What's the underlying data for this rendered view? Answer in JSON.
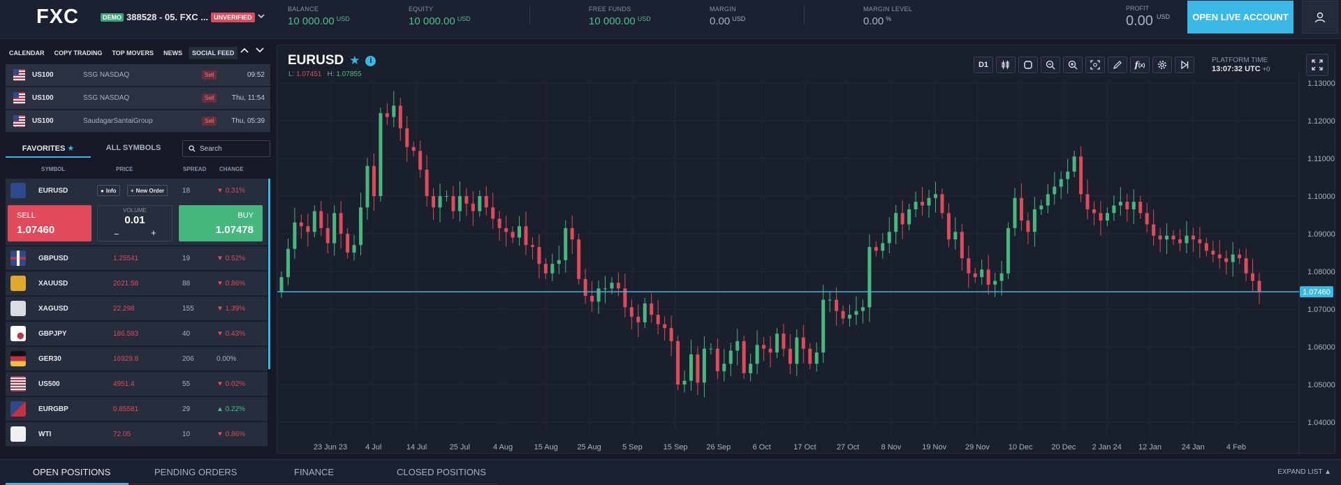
{
  "brand": "FXC",
  "account": {
    "demo": "DEMO",
    "number": "388528 - 05. FXC ...",
    "status": "UNVERIFIED"
  },
  "metrics": [
    {
      "label": "BALANCE",
      "value": "10 000.00",
      "unit": "USD",
      "tone": "green"
    },
    {
      "label": "EQUITY",
      "value": "10 000.00",
      "unit": "USD",
      "tone": "green"
    },
    {
      "label": "FREE FUNDS",
      "value": "10 000.00",
      "unit": "USD",
      "tone": "green"
    },
    {
      "label": "MARGIN",
      "value": "0.00",
      "unit": "USD",
      "tone": "grey"
    },
    {
      "label": "MARGIN LEVEL",
      "value": "0.00",
      "unit": "%",
      "tone": "grey"
    }
  ],
  "profit": {
    "label": "PROFIT",
    "value": "0.00",
    "unit": "USD"
  },
  "open_live": "OPEN LIVE ACCOUNT",
  "left_tabs": [
    "CALENDAR",
    "COPY TRADING",
    "TOP MOVERS",
    "NEWS",
    "SOCIAL FEED"
  ],
  "feed": [
    {
      "symbol": "US100",
      "group": "SSG NASDAQ",
      "side": "Sell",
      "time": "09:52"
    },
    {
      "symbol": "US100",
      "group": "SSG NASDAQ",
      "side": "Sell",
      "time": "Thu, 11:54"
    },
    {
      "symbol": "US100",
      "group": "SaudagarSantaiGroup",
      "side": "Sell",
      "time": "Thu, 05:39"
    }
  ],
  "fav_tabs": {
    "favorites": "FAVORITES",
    "all": "ALL SYMBOLS"
  },
  "search_placeholder": "Search",
  "columns": {
    "symbol": "SYMBOL",
    "price": "PRICE",
    "spread": "SPREAD",
    "change": "CHANGE"
  },
  "expanded": {
    "symbol": "EURUSD",
    "info": "Info",
    "new_order": "New Order",
    "spread": "18",
    "change": "0.31%",
    "sell_label": "SELL",
    "sell_price": "1.07460",
    "buy_label": "BUY",
    "buy_price": "1.07478",
    "volume_label": "VOLUME",
    "volume": "0.01",
    "minus": "−",
    "plus": "+"
  },
  "symbols": [
    {
      "symbol": "GBPUSD",
      "price": "1.25541",
      "spread": "19",
      "change": "0.52%",
      "dir": "down",
      "icon": "flag-gb"
    },
    {
      "symbol": "XAUUSD",
      "price": "2021.58",
      "spread": "88",
      "change": "0.86%",
      "dir": "down",
      "icon": "gold-icon"
    },
    {
      "symbol": "XAGUSD",
      "price": "22.298",
      "spread": "155",
      "change": "1.39%",
      "dir": "down",
      "icon": "silver-icon"
    },
    {
      "symbol": "GBPJPY",
      "price": "186.583",
      "spread": "40",
      "change": "0.43%",
      "dir": "down",
      "icon": "flag-gb-jp"
    },
    {
      "symbol": "GER30",
      "price": "16929.8",
      "spread": "206",
      "change": "0.00%",
      "dir": "flat",
      "icon": "flag-de"
    },
    {
      "symbol": "US500",
      "price": "4951.4",
      "spread": "55",
      "change": "0.02%",
      "dir": "down",
      "icon": "flag-us"
    },
    {
      "symbol": "EURGBP",
      "price": "0.85581",
      "spread": "29",
      "change": "0.22%",
      "dir": "up",
      "icon": "flag-eu-gb"
    },
    {
      "symbol": "WTI",
      "price": "72.05",
      "spread": "10",
      "change": "0.86%",
      "dir": "down",
      "icon": "oil-icon"
    }
  ],
  "bottom_tabs": [
    "OPEN POSITIONS",
    "PENDING ORDERS",
    "FINANCE",
    "CLOSED POSITIONS"
  ],
  "expand_list": "EXPAND LIST",
  "chart": {
    "symbol": "EURUSD",
    "low_label": "L:",
    "low": "1.07451",
    "high_label": "H:",
    "high": "1.07855",
    "timeframe": "D1",
    "platform_time_label": "PLATFORM TIME",
    "platform_time": "13:07:32 UTC",
    "utc_offset": "+0"
  },
  "chart_data": {
    "type": "candlestick",
    "y_ticks": [
      "1.13000",
      "1.12000",
      "1.11000",
      "1.10000",
      "1.09000",
      "1.08000",
      "1.07000",
      "1.06000",
      "1.05000",
      "1.04000"
    ],
    "ylim": [
      1.04,
      1.13
    ],
    "x_ticks": [
      "23 Jun 23",
      "4 Jul",
      "14 Jul",
      "25 Jul",
      "4 Aug",
      "15 Aug",
      "25 Aug",
      "5 Sep",
      "15 Sep",
      "26 Sep",
      "6 Oct",
      "17 Oct",
      "27 Oct",
      "8 Nov",
      "19 Nov",
      "29 Nov",
      "10 Dec",
      "20 Dec",
      "2 Jan 24",
      "12 Jan",
      "24 Jan",
      "4 Feb"
    ],
    "current_price": 1.0746,
    "current_price_label": "1.07460",
    "closes_approx": [
      1.0785,
      1.086,
      1.093,
      1.092,
      1.0905,
      1.096,
      1.0915,
      1.0875,
      1.0955,
      1.09,
      1.085,
      1.087,
      1.097,
      1.108,
      1.1,
      1.122,
      1.121,
      1.124,
      1.118,
      1.113,
      1.112,
      1.107,
      1.1,
      1.097,
      1.1,
      1.1,
      1.096,
      1.1,
      1.098,
      1.096,
      1.1,
      1.097,
      1.094,
      1.0915,
      1.0905,
      1.089,
      1.092,
      1.087,
      1.0865,
      1.082,
      1.0795,
      1.082,
      1.083,
      1.0915,
      1.0885,
      1.078,
      1.0735,
      1.072,
      1.0755,
      1.0755,
      1.077,
      1.0755,
      1.0705,
      1.068,
      1.0665,
      1.0715,
      1.0685,
      1.066,
      1.065,
      1.0615,
      1.05,
      1.051,
      1.058,
      1.0505,
      1.0595,
      1.0595,
      1.0535,
      1.0555,
      1.059,
      1.0615,
      1.053,
      1.0555,
      1.0605,
      1.0595,
      1.0585,
      1.0635,
      1.0595,
      1.0555,
      1.0625,
      1.0595,
      1.0555,
      1.0585,
      1.0725,
      1.0725,
      1.0695,
      1.0675,
      1.0685,
      1.0695,
      1.0705,
      1.0865,
      1.0855,
      1.0875,
      1.0905,
      1.0955,
      1.0925,
      1.0965,
      1.0985,
      1.0975,
      1.0995,
      1.1005,
      1.0955,
      1.0885,
      1.0905,
      1.0835,
      1.0795,
      1.0785,
      1.0805,
      1.0765,
      1.0775,
      1.0795,
      1.0915,
      1.0995,
      1.0935,
      1.0905,
      1.0965,
      1.0975,
      1.1005,
      1.1025,
      1.1045,
      1.1065,
      1.1105,
      1.1005,
      1.0965,
      1.0955,
      1.0935,
      1.0955,
      1.0975,
      1.0985,
      1.0965,
      1.0985,
      1.0955,
      1.0925,
      1.0895,
      1.0885,
      1.0895,
      1.0885,
      1.0875,
      1.0895,
      1.0885,
      1.0875,
      1.0855,
      1.0845,
      1.0835,
      1.0825,
      1.0845,
      1.0835,
      1.0795,
      1.0775,
      1.0746
    ]
  }
}
